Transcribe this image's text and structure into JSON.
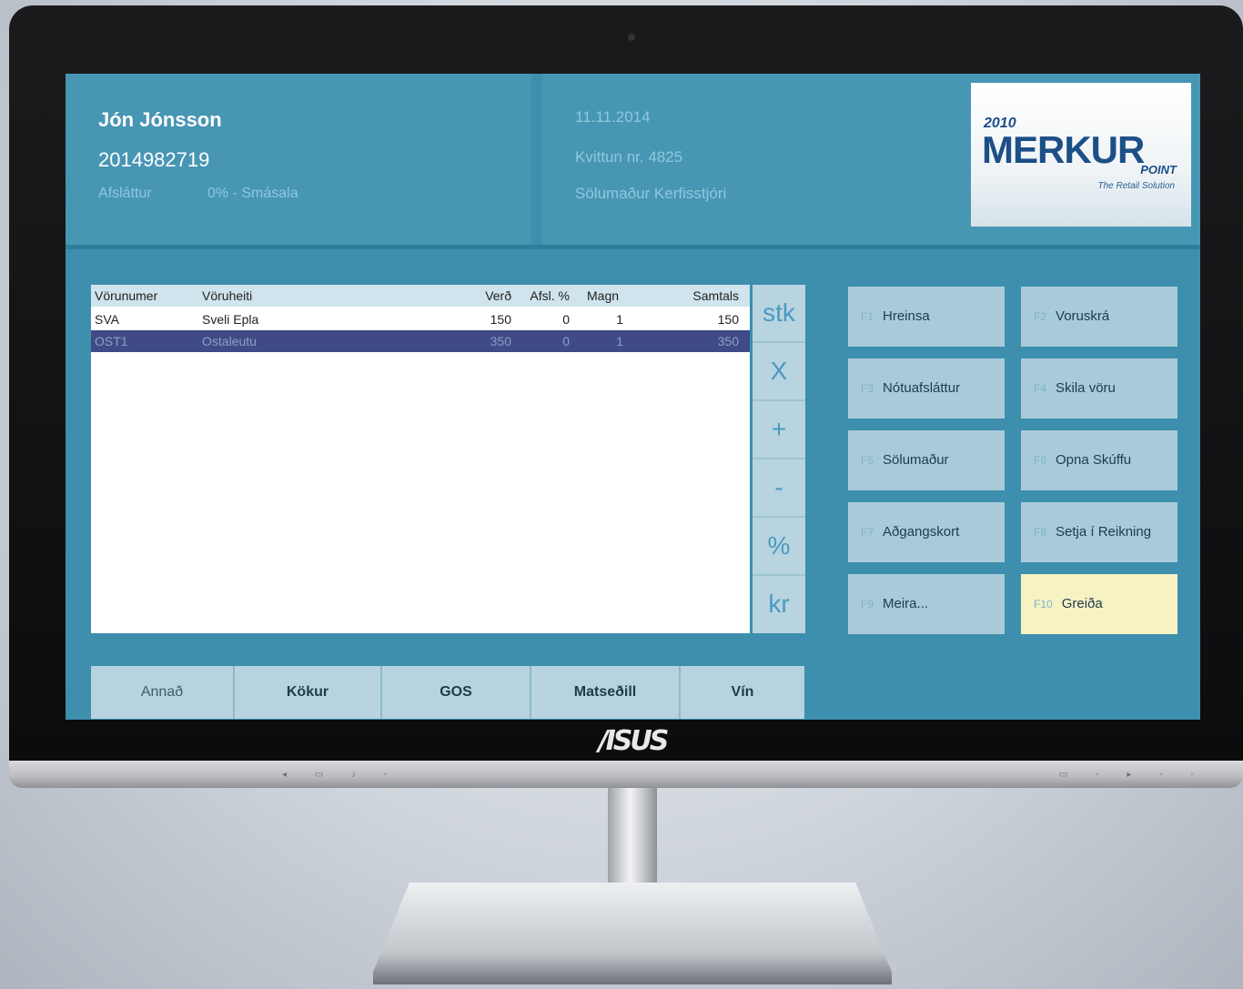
{
  "device": {
    "brand": "/ISUS"
  },
  "header": {
    "customer_name": "Jón Jónsson",
    "customer_id": "2014982719",
    "discount_label": "Afsláttur",
    "discount_value": "0% - Smásala",
    "date": "11.11.2014",
    "receipt": "Kvittun nr. 4825",
    "clerk": "Sölumaður  Kerfisstjóri"
  },
  "logo": {
    "year": "2010",
    "name": "MERKUR",
    "sub": "POINT",
    "tagline": "The Retail Solution"
  },
  "grid": {
    "columns": [
      "Vörunumer",
      "Vöruheiti",
      "Verð",
      "Afsl. %",
      "Magn",
      "Samtals"
    ],
    "rows": [
      [
        "SVA",
        "Sveli Epla",
        "150",
        "0",
        "1",
        "150"
      ],
      [
        "OST1",
        "Ostaleutu",
        "350",
        "0",
        "1",
        "350"
      ]
    ]
  },
  "side_keys": [
    "stk",
    "X",
    "+",
    "-",
    "%",
    "kr"
  ],
  "function_keys": [
    {
      "key": "F1",
      "label": "Hreinsa"
    },
    {
      "key": "F2",
      "label": "Voruskrá"
    },
    {
      "key": "F3",
      "label": "Nótuafsláttur"
    },
    {
      "key": "F4",
      "label": "Skila vöru"
    },
    {
      "key": "F5",
      "label": "Sölumaður"
    },
    {
      "key": "F6",
      "label": "Opna Skúffu"
    },
    {
      "key": "F7",
      "label": "Aðgangskort"
    },
    {
      "key": "F8",
      "label": "Setja í Reikning"
    },
    {
      "key": "F9",
      "label": "Meira..."
    },
    {
      "key": "F10",
      "label": "Greiða"
    }
  ],
  "tabs": [
    "Annað",
    "Kökur",
    "GOS",
    "Matseðill",
    "Vín"
  ]
}
